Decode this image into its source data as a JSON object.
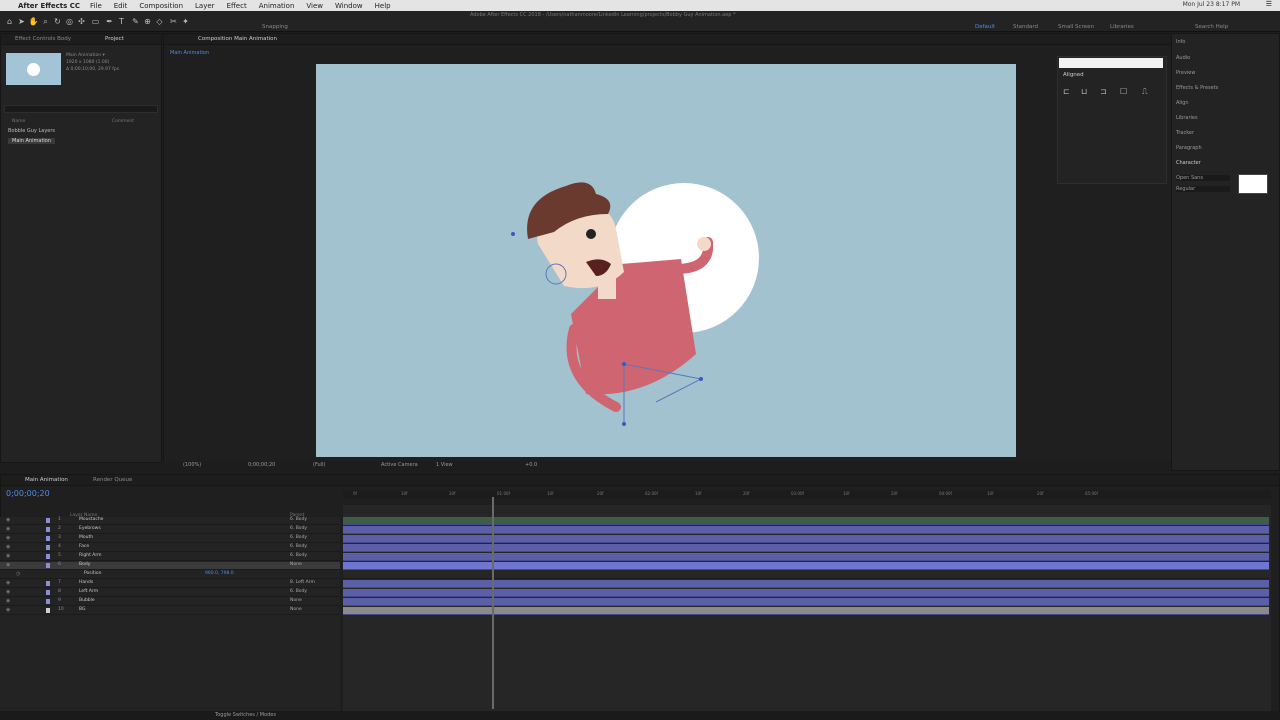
{
  "menubar": {
    "apple": "",
    "app_name": "After Effects CC",
    "items": [
      "File",
      "Edit",
      "Composition",
      "Layer",
      "Effect",
      "Animation",
      "View",
      "Window",
      "Help"
    ],
    "clock": "Mon Jul 23  8:17 PM"
  },
  "toolbar": {
    "title": "Adobe After Effects CC 2018 - /Users/nathanmoore/LinkedIn Learning/projects/Bobby Guy Animation.aep *",
    "snapping": "Snapping",
    "workspaces": {
      "default": "Default",
      "standard": "Standard",
      "small_screen": "Small Screen",
      "libraries": "Libraries",
      "search": "Search Help"
    }
  },
  "project": {
    "tab_effect": "Effect Controls Body",
    "tab_project": "Project",
    "comp_name": "Main Animation ▾",
    "comp_meta1": "1920 x 1080 (1.00)",
    "comp_meta2": "Δ 0;00;10;00, 29.97 fps",
    "col_name": "Name",
    "col_type": "Comment",
    "items": [
      "Bobble Guy Layers",
      "Main Animation"
    ]
  },
  "comp": {
    "tab": "Composition Main Animation",
    "sub_tab": "Main Animation",
    "zoom": "(100%)",
    "timecode": "0;00;00;20",
    "quality": "(Full)",
    "camera": "Active Camera",
    "views": "1 View",
    "exposure": "+0.0"
  },
  "align": {
    "title": "Aligned",
    "tab": "Align"
  },
  "right_panel": {
    "items": [
      "Info",
      "Audio",
      "Preview",
      "Effects & Presets",
      "Align",
      "Libraries",
      "Tracker",
      "Paragraph",
      "Character"
    ],
    "font": "Open Sans",
    "style": "Regular"
  },
  "timeline": {
    "tab_main": "Main Animation",
    "tab_render": "Render Queue",
    "timecode": "0;00;00;20",
    "col_layer_name": "Layer Name",
    "col_parent": "Parent",
    "layers": [
      {
        "num": "1",
        "name": "Moustache",
        "parent": "6. Body",
        "color": "#8a8fd6"
      },
      {
        "num": "2",
        "name": "Eyebrows",
        "parent": "6. Body",
        "color": "#8a8fd6"
      },
      {
        "num": "3",
        "name": "Mouth",
        "parent": "6. Body",
        "color": "#8a8fd6"
      },
      {
        "num": "4",
        "name": "Face",
        "parent": "6. Body",
        "color": "#8a8fd6"
      },
      {
        "num": "5",
        "name": "Right Arm",
        "parent": "6. Body",
        "color": "#8a8fd6"
      },
      {
        "num": "6",
        "name": "Body",
        "parent": "None",
        "color": "#8a8fd6"
      },
      {
        "num": "",
        "name": "Position",
        "parent": "",
        "color": ""
      },
      {
        "num": "7",
        "name": "Hands",
        "parent": "8. Left Arm",
        "color": "#8a8fd6"
      },
      {
        "num": "8",
        "name": "Left Arm",
        "parent": "6. Body",
        "color": "#8a8fd6"
      },
      {
        "num": "9",
        "name": "Bubble",
        "parent": "None",
        "color": "#8a8fd6"
      },
      {
        "num": "10",
        "name": "BG",
        "parent": "None",
        "color": "#d0d0d0"
      }
    ],
    "position_value": "960.0, 798.0",
    "ruler_labels": [
      "0f",
      "10f",
      "20f",
      "01:00f",
      "10f",
      "20f",
      "02:00f",
      "10f",
      "20f",
      "03:00f",
      "10f",
      "20f",
      "04:00f",
      "10f",
      "20f",
      "05:00f"
    ],
    "status": "Toggle Switches / Modes"
  },
  "colors": {
    "accent": "#4a8ee8",
    "canvas_bg": "#a3c2cf",
    "layer_bar": "#5a5fa8",
    "shirt": "#cf6570",
    "skin": "#f2d9c8",
    "hair": "#6b3a2e"
  }
}
